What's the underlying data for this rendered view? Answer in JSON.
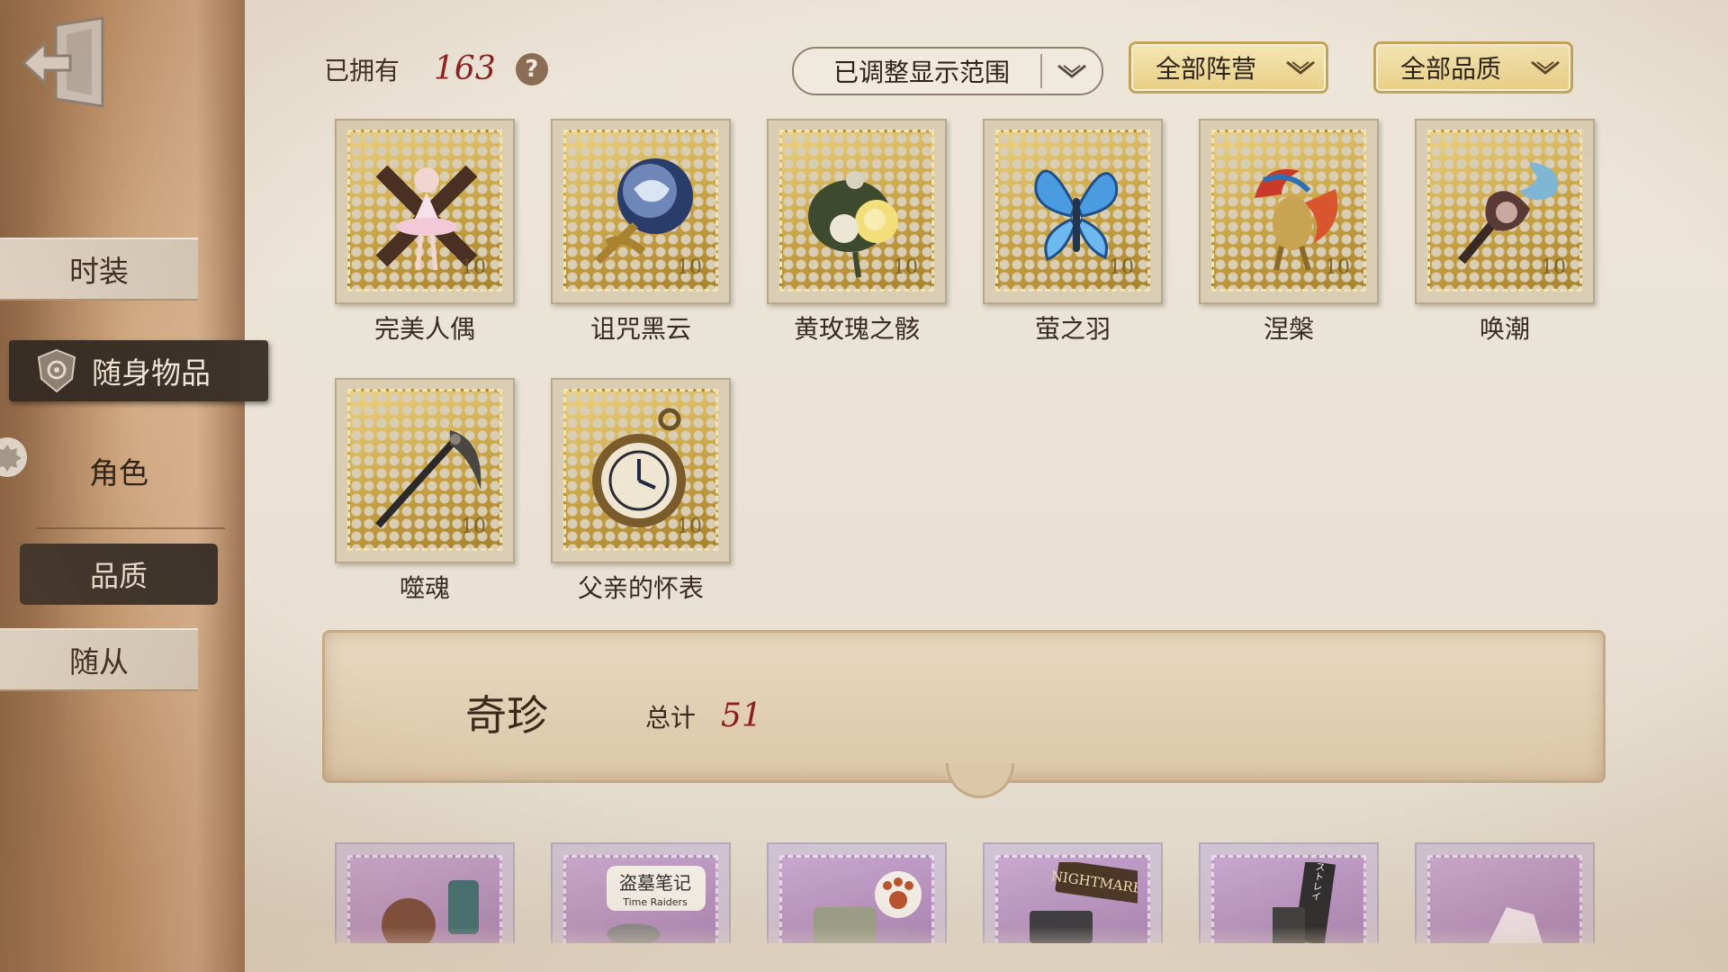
{
  "sidebar": {
    "items": [
      {
        "label": "时装"
      },
      {
        "label": "随身物品"
      },
      {
        "label": "角色"
      },
      {
        "label": "品质"
      },
      {
        "label": "随从"
      }
    ]
  },
  "header": {
    "owned_label": "已拥有",
    "owned_count": "163",
    "help_symbol": "?",
    "filters": [
      {
        "label": "已调整显示范围"
      },
      {
        "label": "全部阵营"
      },
      {
        "label": "全部品质"
      }
    ]
  },
  "items": [
    {
      "name": "完美人偶",
      "icon": "ballerina-doll-icon"
    },
    {
      "name": "诅咒黑云",
      "icon": "cursed-orb-icon"
    },
    {
      "name": "黄玫瑰之骸",
      "icon": "yellow-rose-icon"
    },
    {
      "name": "萤之羽",
      "icon": "blue-butterfly-icon"
    },
    {
      "name": "涅槃",
      "icon": "phoenix-icon"
    },
    {
      "name": "唤潮",
      "icon": "tide-staff-icon"
    },
    {
      "name": "噬魂",
      "icon": "scythe-icon"
    },
    {
      "name": "父亲的怀表",
      "icon": "pocket-watch-icon"
    }
  ],
  "stamp_value": "10",
  "rarity_section": {
    "title": "奇珍",
    "total_label": "总计",
    "total_count": "51",
    "preview_stamps": [
      {
        "icon": "lantern-icon"
      },
      {
        "icon": "time-raiders-badge-icon",
        "text": "盗墓笔记",
        "subtext": "Time Raiders"
      },
      {
        "icon": "paw-sticker-icon"
      },
      {
        "icon": "nightmares-book-icon",
        "text": "NIGHTMARES"
      },
      {
        "icon": "stray-dogs-book-icon",
        "text": "文豪ストレイ"
      },
      {
        "icon": "crystal-icon"
      }
    ]
  },
  "colors": {
    "accent_red": "#8c1d1d",
    "gold_filter": "#e8cf86",
    "sidebar_active": "#2d2620"
  }
}
